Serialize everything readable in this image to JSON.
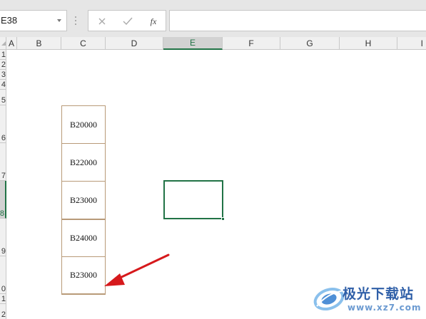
{
  "formula_bar": {
    "name_box": "E38",
    "cancel_icon": "close-icon",
    "enter_icon": "check-icon",
    "fx_label": "fx",
    "formula": ""
  },
  "columns": [
    "A",
    "B",
    "C",
    "D",
    "E",
    "F",
    "G",
    "H",
    "I"
  ],
  "active_column": "E",
  "rows": [
    "1",
    "2",
    "3",
    "4",
    "5",
    "6",
    "7",
    "8",
    "9",
    "0",
    "1",
    "2"
  ],
  "active_row_index": 7,
  "cells": [
    "B20000",
    "B22000",
    "B23000",
    "B24000",
    "B23000"
  ],
  "annotation": {
    "type": "red-arrow",
    "color": "#d6191c"
  },
  "watermark": {
    "name": "极光下载站",
    "url": "www.xz7.com"
  },
  "colors": {
    "accent": "#217346",
    "cell_border": "#b89a78"
  }
}
